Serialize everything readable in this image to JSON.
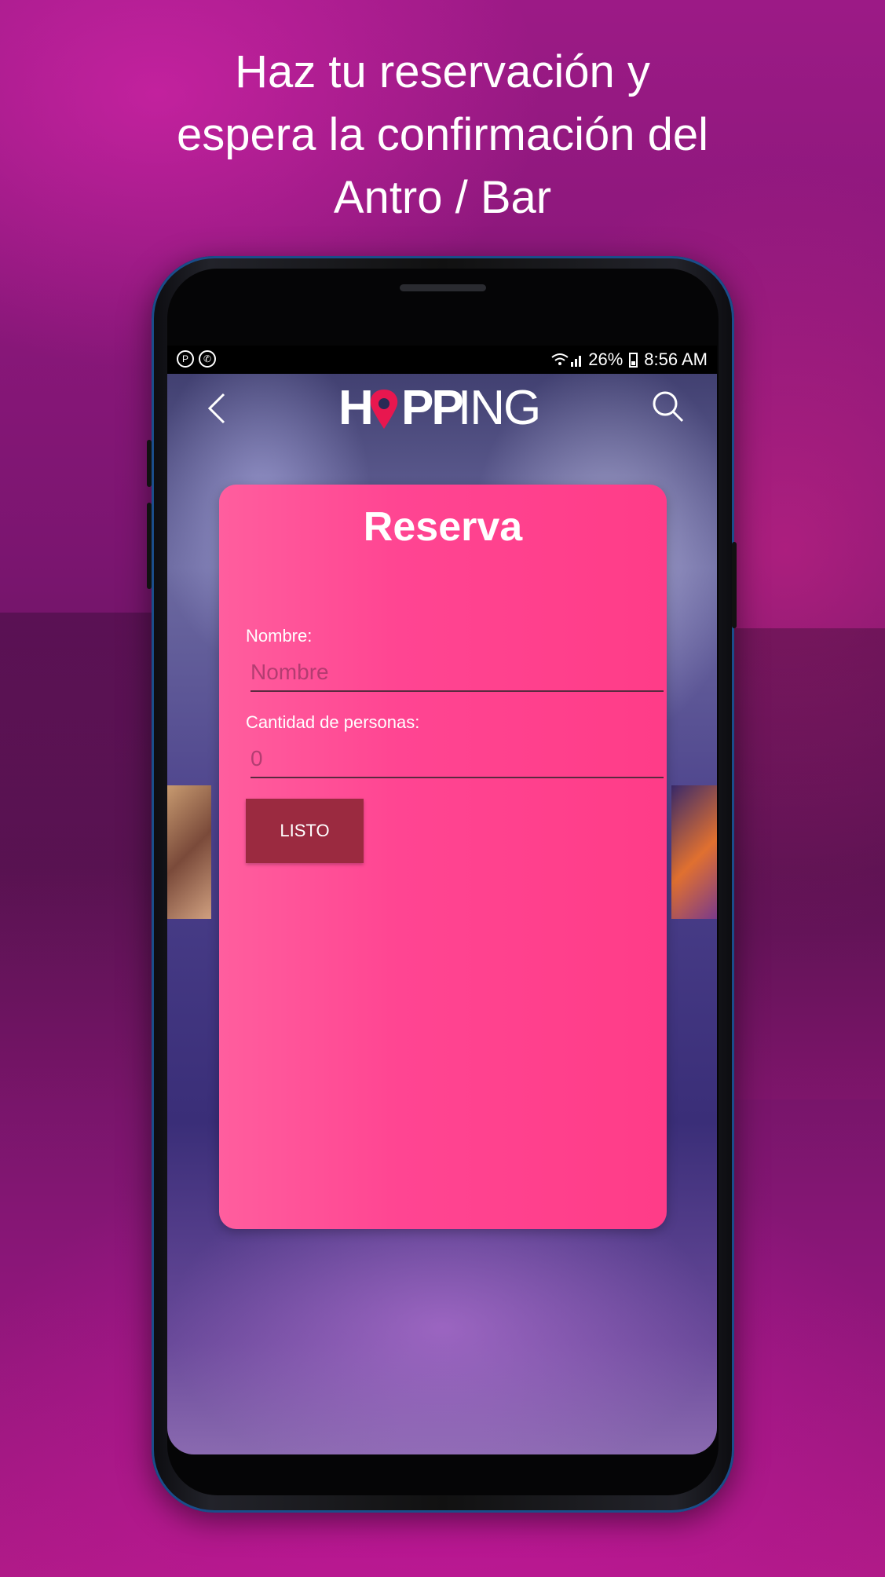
{
  "headline": {
    "line1": "Haz tu reservación y",
    "line2": "espera la confirmación del",
    "line3": "Antro / Bar"
  },
  "statusbar": {
    "left_icons": [
      "pinterest-icon",
      "whatsapp-icon"
    ],
    "battery": "26%",
    "time": "8:56 AM"
  },
  "appbar": {
    "logo": "HOPPING",
    "back_icon": "chevron-left-icon",
    "search_icon": "search-icon"
  },
  "reservation": {
    "title": "Reserva",
    "name_label": "Nombre:",
    "name_placeholder": "Nombre",
    "people_label": "Cantidad de personas:",
    "people_placeholder": "0",
    "submit_label": "LISTO"
  },
  "colors": {
    "card": "#ff4592",
    "button": "#9b2a40",
    "background": "#8a1678",
    "logo_pin": "#e8174f"
  }
}
